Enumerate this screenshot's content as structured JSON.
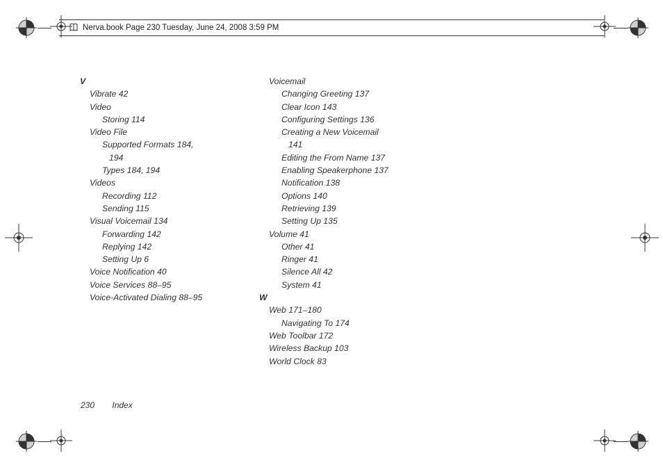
{
  "header": {
    "text": "Nerva.book  Page 230  Tuesday, June 24, 2008  3:59 PM"
  },
  "index": {
    "col1": {
      "letter": "V",
      "lines": [
        {
          "cls": "entry-0",
          "text": "Vibrate 42"
        },
        {
          "cls": "entry-0",
          "text": "Video"
        },
        {
          "cls": "entry-1",
          "text": "Storing 114"
        },
        {
          "cls": "entry-0",
          "text": "Video File"
        },
        {
          "cls": "entry-1",
          "text": "Supported Formats 184,"
        },
        {
          "cls": "entry-2",
          "text": "194"
        },
        {
          "cls": "entry-1",
          "text": "Types 184, 194"
        },
        {
          "cls": "entry-0",
          "text": "Videos"
        },
        {
          "cls": "entry-1",
          "text": "Recording 112"
        },
        {
          "cls": "entry-1",
          "text": "Sending 115"
        },
        {
          "cls": "entry-0",
          "text": "Visual Voicemail 134"
        },
        {
          "cls": "entry-1",
          "text": "Forwarding 142"
        },
        {
          "cls": "entry-1",
          "text": "Replying 142"
        },
        {
          "cls": "entry-1",
          "text": "Setting Up 6"
        },
        {
          "cls": "entry-0",
          "text": "Voice Notification 40"
        },
        {
          "cls": "entry-0",
          "text": "Voice Services 88–95"
        },
        {
          "cls": "entry-0",
          "text": "Voice-Activated Dialing 88–95"
        }
      ]
    },
    "col2": {
      "lines": [
        {
          "cls": "entry-0",
          "text": "Voicemail"
        },
        {
          "cls": "entry-1",
          "text": "Changing Greeting 137"
        },
        {
          "cls": "entry-1",
          "text": "Clear Icon 143"
        },
        {
          "cls": "entry-1",
          "text": "Configuring Settings 136"
        },
        {
          "cls": "entry-1",
          "text": "Creating a New Voicemail"
        },
        {
          "cls": "entry-2",
          "text": "141"
        },
        {
          "cls": "entry-1",
          "text": "Editing the From Name 137"
        },
        {
          "cls": "entry-1",
          "text": "Enabling Speakerphone 137"
        },
        {
          "cls": "entry-1",
          "text": "Notification 138"
        },
        {
          "cls": "entry-1",
          "text": "Options 140"
        },
        {
          "cls": "entry-1",
          "text": "Retrieving 139"
        },
        {
          "cls": "entry-1",
          "text": "Setting Up 135"
        },
        {
          "cls": "entry-0",
          "text": "Volume 41"
        },
        {
          "cls": "entry-1",
          "text": "Other 41"
        },
        {
          "cls": "entry-1",
          "text": "Ringer 41"
        },
        {
          "cls": "entry-1",
          "text": "Silence All 42"
        },
        {
          "cls": "entry-1",
          "text": "System 41"
        }
      ],
      "letterW": "W",
      "linesW": [
        {
          "cls": "entry-0",
          "text": "Web 171–180"
        },
        {
          "cls": "entry-1",
          "text": "Navigating To 174"
        },
        {
          "cls": "entry-0",
          "text": "Web Toolbar 172"
        },
        {
          "cls": "entry-0",
          "text": "Wireless Backup 103"
        },
        {
          "cls": "entry-0",
          "text": "World Clock 83"
        }
      ]
    }
  },
  "footer": {
    "page": "230",
    "section": "Index"
  }
}
